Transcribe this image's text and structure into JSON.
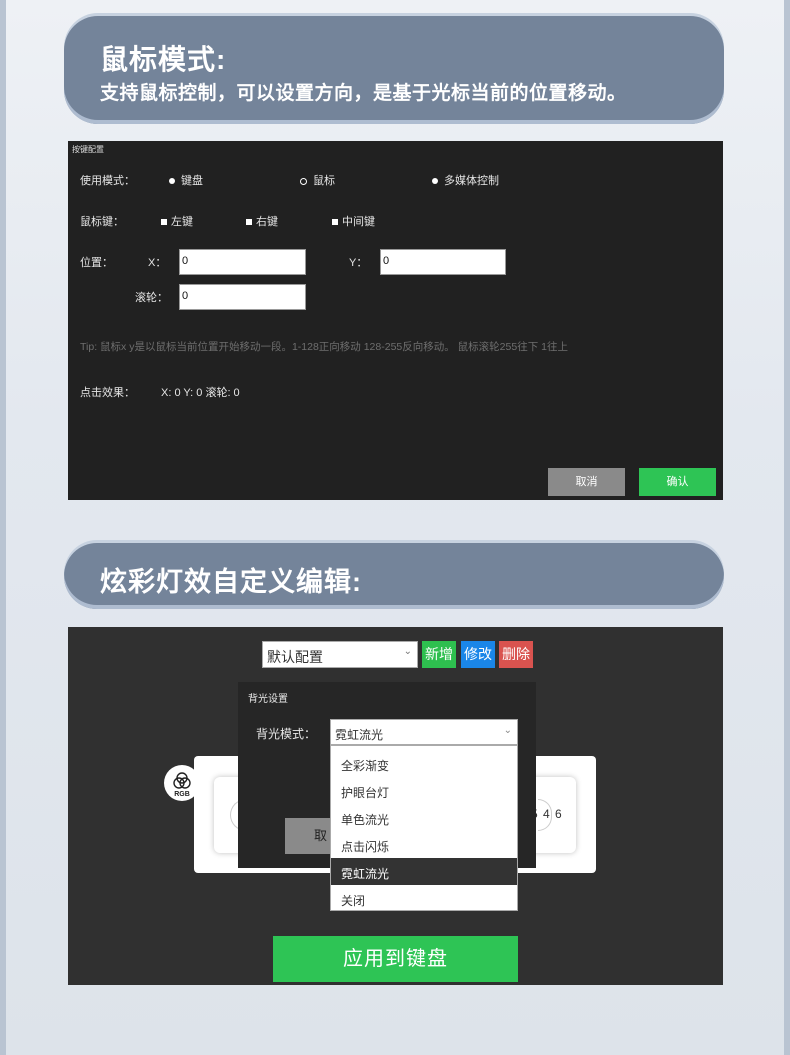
{
  "section1": {
    "title": "鼠标模式:",
    "subtitle": "支持鼠标控制，可以设置方向，是基于光标当前的位置移动。"
  },
  "key_config": {
    "title": "按键配置",
    "mode_label": "使用模式：",
    "mode_options": [
      "键盘",
      "鼠标",
      "多媒体控制"
    ],
    "mouse_key_label": "鼠标键：",
    "mouse_keys": [
      "左键",
      "右键",
      "中间键"
    ],
    "position_label": "位置：",
    "x_label": "X：",
    "x_value": "0",
    "y_label": "Y：",
    "y_value": "0",
    "wheel_label": "滚轮：",
    "wheel_value": "0",
    "tip": "Tip: 鼠标x y是以鼠标当前位置开始移动一段。1-128正向移动 128-255反向移动。 鼠标滚轮255往下 1往上",
    "effect_label": "点击效果：",
    "effect_value": "X: 0 Y: 0 滚轮: 0",
    "cancel_label": "取消",
    "confirm_label": "确认"
  },
  "section2": {
    "title": "炫彩灯效自定义编辑:"
  },
  "rgb_editor": {
    "preset_value": "默认配置",
    "new_label": "新增",
    "edit_label": "修改",
    "delete_label": "删除",
    "badge_text": "RGB",
    "keyboard_digits": "5 4 6",
    "backlight": {
      "title": "背光设置",
      "mode_label": "背光模式：",
      "mode_value": "霓虹流光",
      "cancel_partial": "取",
      "options": [
        "全彩渐变",
        "护眼台灯",
        "单色流光",
        "点击闪烁",
        "霓虹流光",
        "关闭"
      ],
      "selected_index": 4
    },
    "apply_label": "应用到键盘"
  },
  "colors": {
    "banner": "#74849a",
    "dialog_bg": "#212121",
    "confirm_green": "#2ec455",
    "new_green": "#2ebf4f",
    "edit_blue": "#1a86e8",
    "delete_red": "#d9534f"
  }
}
